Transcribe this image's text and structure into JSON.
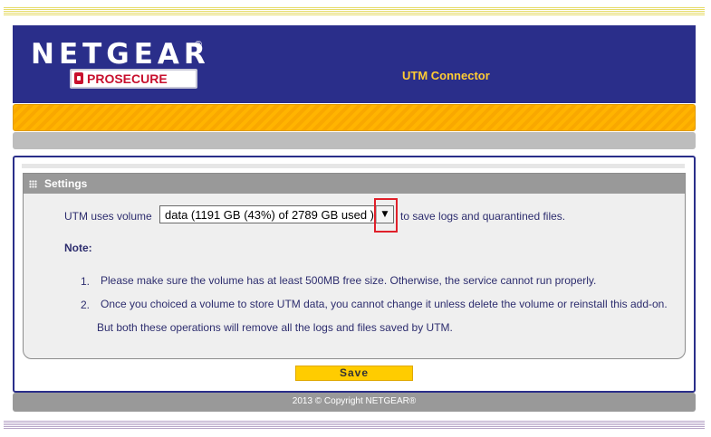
{
  "header": {
    "logo": "NETGEAR",
    "logo_sub": "PROSECURE",
    "title": "UTM Connector"
  },
  "settings": {
    "title": "Settings",
    "utm_label": "UTM uses volume",
    "volume_selected": "data (1191 GB (43%) of 2789 GB used )",
    "after_text": "to save logs and quarantined files.",
    "note_label": "Note:",
    "notes": [
      {
        "num": "1.",
        "text": "Please make sure the volume has at least 500MB free size. Otherwise, the service cannot run properly."
      },
      {
        "num": "2.",
        "text": "Once you choiced a volume to store UTM data, you cannot change it unless delete the volume or reinstall this add-on. But both these operations will remove all the logs and files saved by UTM."
      }
    ]
  },
  "save_label": "Save",
  "footer": "2013 © Copyright NETGEAR®",
  "icons": {
    "lock": "lock-icon",
    "grid": "grid-icon",
    "dropdown": "chevron-down-icon"
  },
  "colors": {
    "header_bg": "#2a2e8a",
    "title": "#ffcc33",
    "accent_orange": "#ffb400",
    "save_button": "#ffcc00",
    "highlight": "#e0202a"
  }
}
